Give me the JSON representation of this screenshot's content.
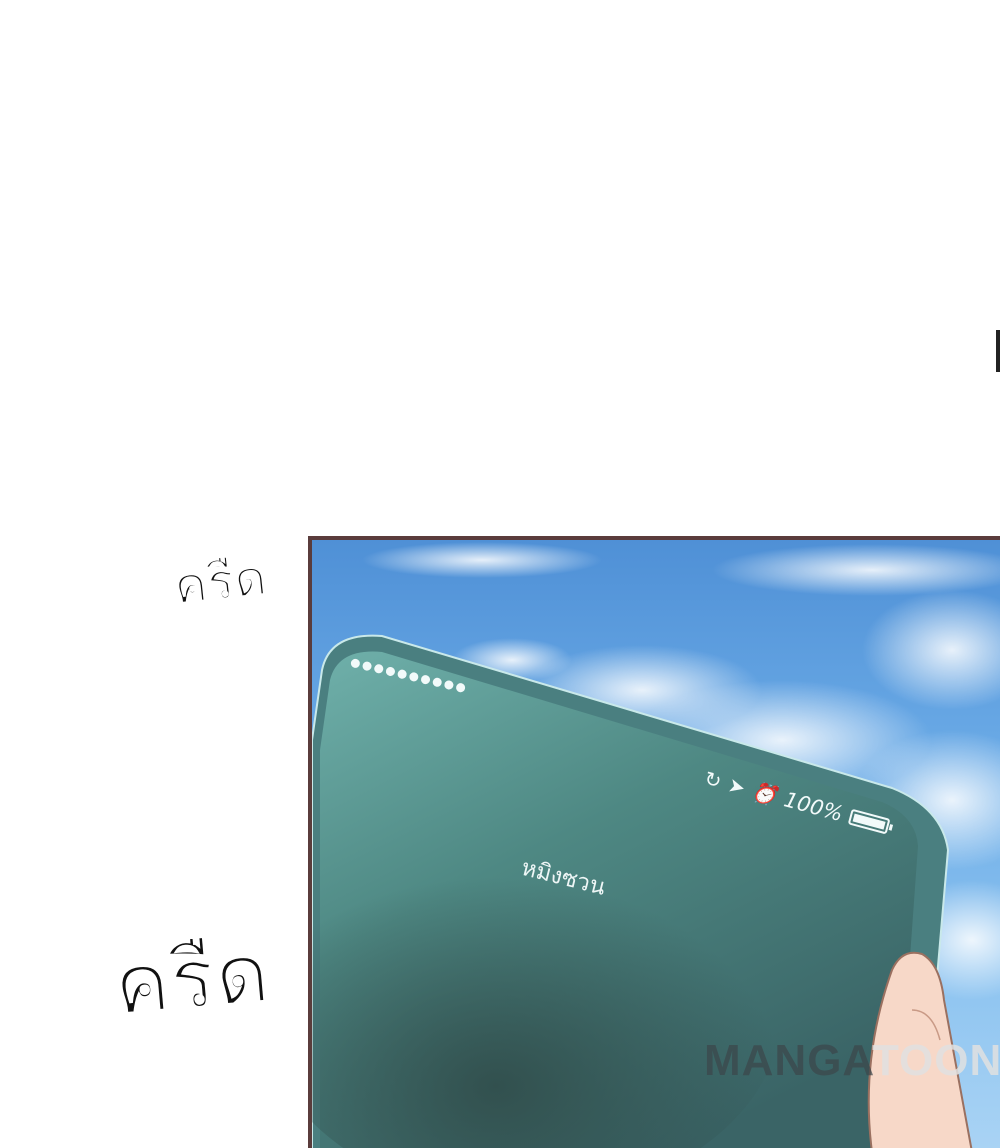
{
  "sound_effects": {
    "small": "ครืด",
    "large": "ครืด"
  },
  "phone": {
    "contact_name": "หมิงซวน",
    "battery_percent": "100%",
    "battery_level": 1.0,
    "signal_dots": 10,
    "status_icons": [
      "rotation-lock-icon",
      "location-arrow-icon",
      "alarm-clock-icon"
    ]
  },
  "watermark": {
    "part1": "MANGA",
    "part2": "TOON"
  },
  "colors": {
    "panel_border": "#5a3c3c",
    "sky": "#6aaae6",
    "phone_body": "#4f8585",
    "phone_screen": "#5d9b9a",
    "sfx_text": "#111111",
    "hand": "#f7d8c8"
  }
}
